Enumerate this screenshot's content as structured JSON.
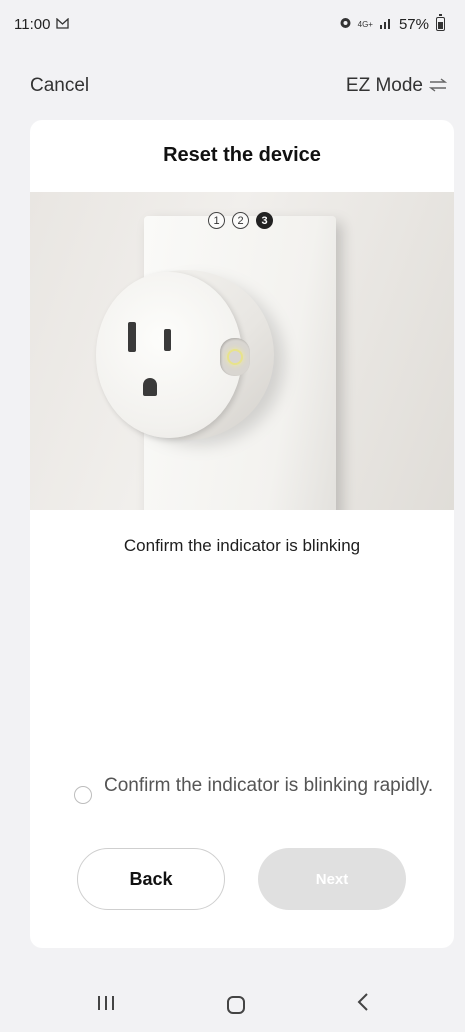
{
  "status_bar": {
    "time": "11:00",
    "notification_icon": "mail-icon",
    "alarm_icon": "alarm-icon",
    "network": "4G+",
    "signal_icon": "signal-icon",
    "battery": "57%"
  },
  "nav": {
    "cancel_label": "Cancel",
    "mode_label": "EZ Mode",
    "mode_icon": "swap-icon"
  },
  "card": {
    "title": "Reset the device",
    "steps": [
      {
        "label": "1",
        "active": false
      },
      {
        "label": "2",
        "active": false
      },
      {
        "label": "3",
        "active": true
      }
    ],
    "instruction": "Confirm the indicator is blinking",
    "confirm_label": "Confirm the indicator is blinking rapidly.",
    "confirm_checked": false,
    "back_label": "Back",
    "next_label": "Next"
  },
  "system_nav": {
    "recent_icon": "recent-apps-icon",
    "home_icon": "home-icon",
    "back_icon": "back-icon"
  }
}
